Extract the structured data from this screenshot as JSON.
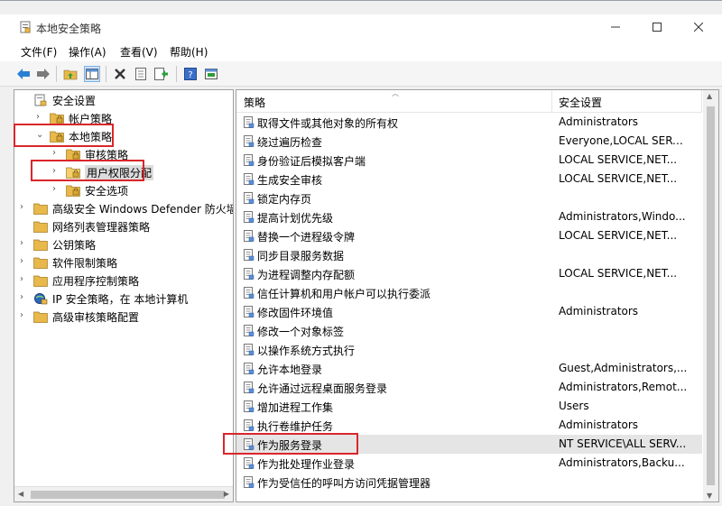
{
  "window": {
    "title": "本地安全策略"
  },
  "menu": [
    {
      "label": "文件(F)"
    },
    {
      "label": "操作(A)"
    },
    {
      "label": "查看(V)"
    },
    {
      "label": "帮助(H)"
    }
  ],
  "tree": [
    {
      "label": "安全设置"
    },
    {
      "label": "帐户策略"
    },
    {
      "label": "本地策略"
    },
    {
      "label": "审核策略"
    },
    {
      "label": "用户权限分配"
    },
    {
      "label": "安全选项"
    },
    {
      "label": "高级安全 Windows Defender 防火墙"
    },
    {
      "label": "网络列表管理器策略"
    },
    {
      "label": "公钥策略"
    },
    {
      "label": "软件限制策略"
    },
    {
      "label": "应用程序控制策略"
    },
    {
      "label": "IP 安全策略，在 本地计算机"
    },
    {
      "label": "高级审核策略配置"
    }
  ],
  "list": {
    "columns": [
      "策略",
      "安全设置"
    ],
    "rows": [
      {
        "policy": "取得文件或其他对象的所有权",
        "setting": "Administrators"
      },
      {
        "policy": "绕过遍历检查",
        "setting": "Everyone,LOCAL SERVICE,..."
      },
      {
        "policy": "身份验证后模拟客户端",
        "setting": "LOCAL SERVICE,NET..."
      },
      {
        "policy": "生成安全审核",
        "setting": "LOCAL SERVICE,NET..."
      },
      {
        "policy": "锁定内存页",
        "setting": ""
      },
      {
        "policy": "提高计划优先级",
        "setting": "Administrators,Windo..."
      },
      {
        "policy": "替换一个进程级令牌",
        "setting": "LOCAL SERVICE,NET..."
      },
      {
        "policy": "同步目录服务数据",
        "setting": ""
      },
      {
        "policy": "为进程调整内存配额",
        "setting": "LOCAL SERVICE,NET..."
      },
      {
        "policy": "信任计算机和用户帐户可以执行委派",
        "setting": ""
      },
      {
        "policy": "修改固件环境值",
        "setting": "Administrators"
      },
      {
        "policy": "修改一个对象标签",
        "setting": ""
      },
      {
        "policy": "以操作系统方式执行",
        "setting": ""
      },
      {
        "policy": "允许本地登录",
        "setting": "Guest,Administrators,..."
      },
      {
        "policy": "允许通过远程桌面服务登录",
        "setting": "Administrators,Remot..."
      },
      {
        "policy": "增加进程工作集",
        "setting": "Users"
      },
      {
        "policy": "执行卷维护任务",
        "setting": "Administrators"
      },
      {
        "policy": "作为服务登录",
        "setting": "NT SERVICE\\ALL SERV..."
      },
      {
        "policy": "作为批处理作业登录",
        "setting": "Administrators,Backu..."
      },
      {
        "policy": "作为受信任的呼叫方访问凭据管理器",
        "setting": ""
      }
    ]
  },
  "colors": {
    "highlight": "#d9262c",
    "folder": "#e8b84a",
    "selected_row": "#e5e5e5"
  }
}
